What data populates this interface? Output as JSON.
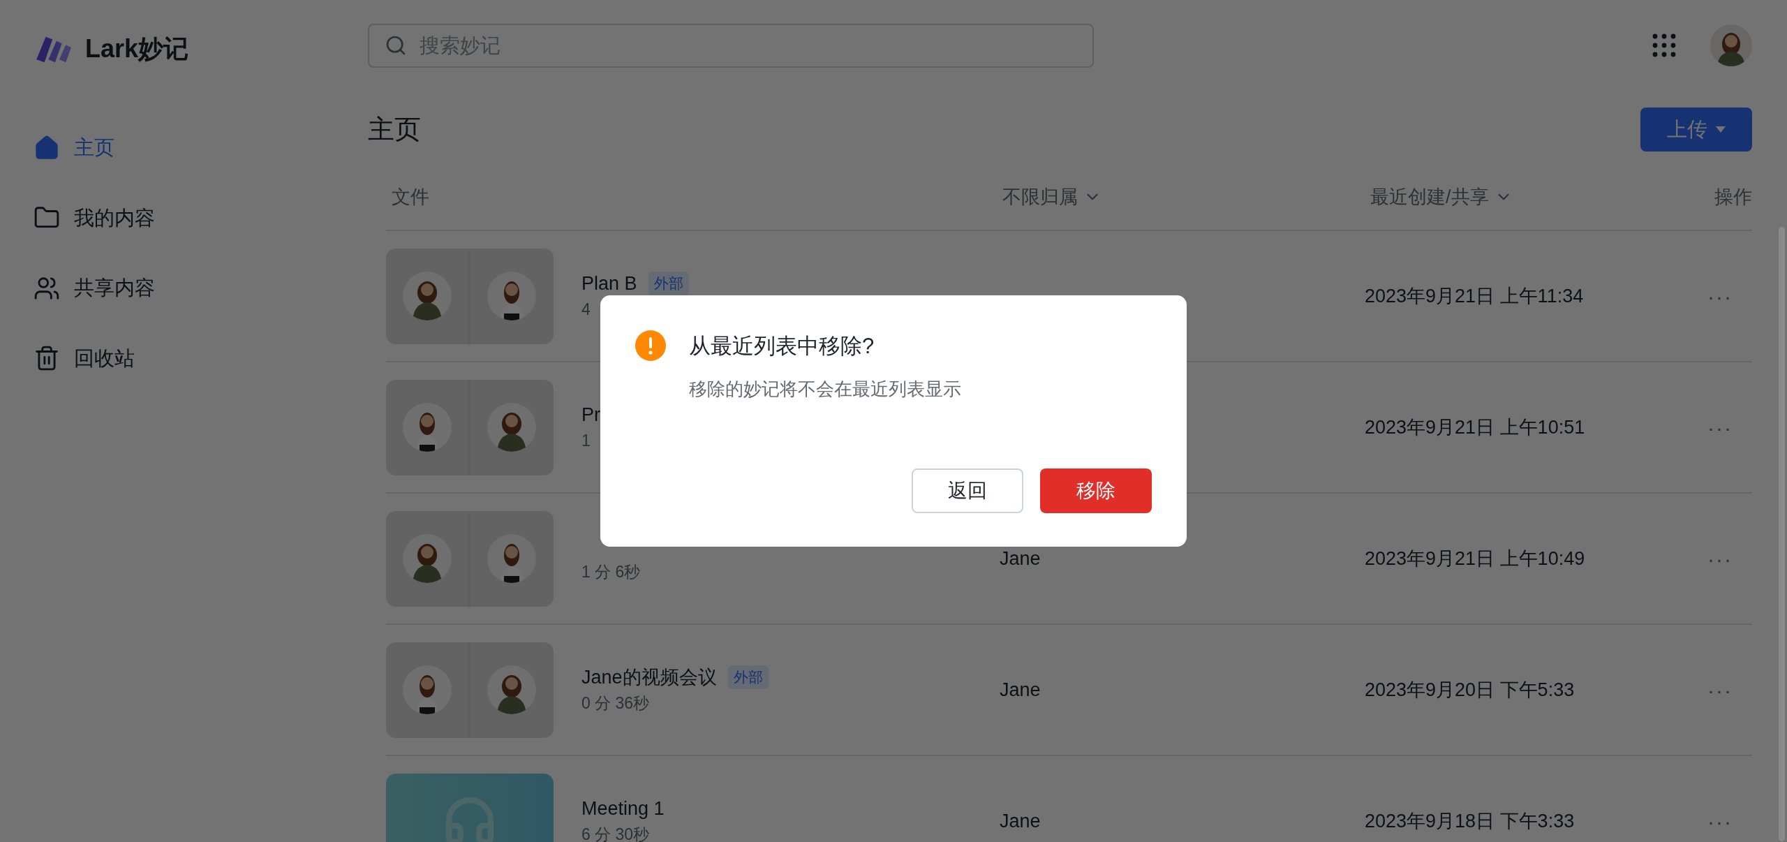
{
  "app": {
    "logo_text": "Lark妙记"
  },
  "search": {
    "placeholder": "搜索妙记"
  },
  "sidebar": {
    "items": [
      {
        "label": "主页",
        "selected": true
      },
      {
        "label": "我的内容",
        "selected": false
      },
      {
        "label": "共享内容",
        "selected": false
      },
      {
        "label": "回收站",
        "selected": false
      }
    ]
  },
  "page": {
    "title": "主页",
    "upload_button": "上传"
  },
  "table": {
    "columns": [
      {
        "label": "文件",
        "dropdown": false
      },
      {
        "label": "不限归属",
        "dropdown": true
      },
      {
        "label": "最近创建/共享",
        "dropdown": true
      },
      {
        "label": "操作",
        "dropdown": false
      }
    ],
    "rows": [
      {
        "kind": "video",
        "title": "Plan B",
        "badge": "外部",
        "duration": "4",
        "date": "2023年9月21日 上午11:34",
        "more": "···"
      },
      {
        "kind": "video",
        "title": "Pr",
        "duration": "1",
        "date": "2023年9月21日 上午10:51",
        "more": "···"
      },
      {
        "kind": "video",
        "duration": "1 分 6秒",
        "owner": "Jane",
        "date": "2023年9月21日 上午10:49",
        "more": "···"
      },
      {
        "kind": "video",
        "title": "Jane的视频会议",
        "badge": "外部",
        "duration": "0 分 36秒",
        "owner": "Jane",
        "date": "2023年9月20日 下午5:33",
        "more": "···"
      },
      {
        "kind": "audio",
        "title": "Meeting 1",
        "duration": "6 分 30秒",
        "owner": "Jane",
        "date": "2023年9月18日 下午3:33",
        "more": "···"
      }
    ]
  },
  "dialog": {
    "title": "从最近列表中移除?",
    "message": "移除的妙记将不会在最近列表显示",
    "buttons": [
      {
        "label": "返回",
        "kind": "secondary"
      },
      {
        "label": "移除",
        "kind": "danger"
      }
    ]
  }
}
